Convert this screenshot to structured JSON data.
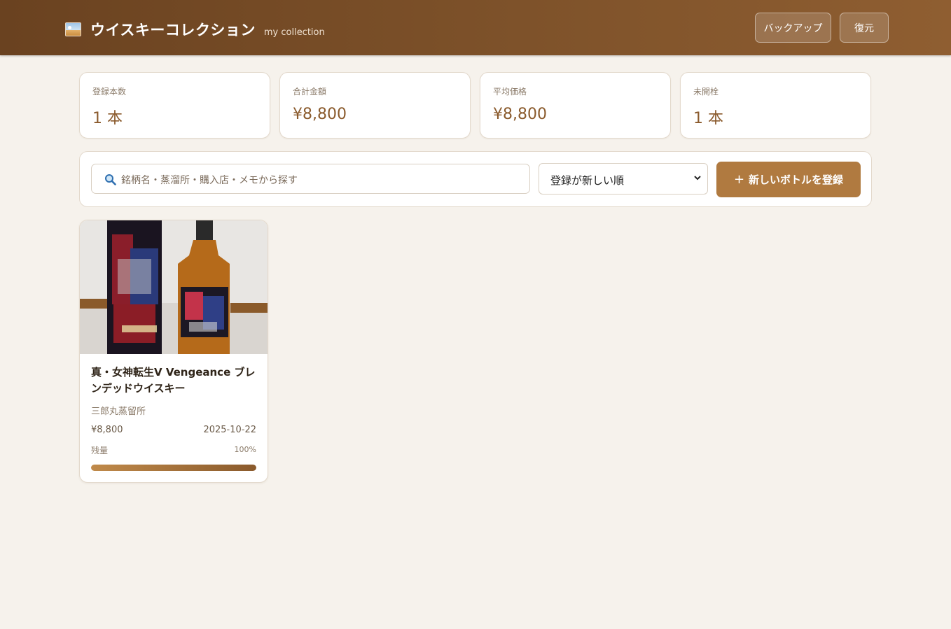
{
  "header": {
    "title": "ウイスキーコレクション",
    "subtitle": "my collection",
    "backup_label": "バックアップ",
    "restore_label": "復元"
  },
  "stats": [
    {
      "label": "登録本数",
      "value": "1 本"
    },
    {
      "label": "合計金額",
      "value": "¥8,800"
    },
    {
      "label": "平均価格",
      "value": "¥8,800"
    },
    {
      "label": "未開栓",
      "value": "1 本"
    }
  ],
  "toolbar": {
    "search_placeholder": "銘柄名・蒸溜所・購入店・メモから探す",
    "sort_selected": "登録が新しい順",
    "add_label": "新しいボトルを登録",
    "add_icon": "+"
  },
  "bottles": [
    {
      "name": "真・女神転生V Vengeance ブレンデッドウイスキー",
      "distillery": "三郎丸蒸留所",
      "price": "¥8,800",
      "date": "2025-10-22",
      "remaining_label": "残量",
      "remaining_text": "100%",
      "remaining": 100
    }
  ],
  "colors": {
    "header_start": "#6a4220",
    "header_end": "#8f5e31",
    "accent": "#b07a40",
    "stat_value": "#8a5a2c",
    "page_bg": "#f6f2ec"
  },
  "icons": {
    "brand": "whisky-photo-icon",
    "search": "search-icon",
    "sort": "chevron-down-icon"
  }
}
